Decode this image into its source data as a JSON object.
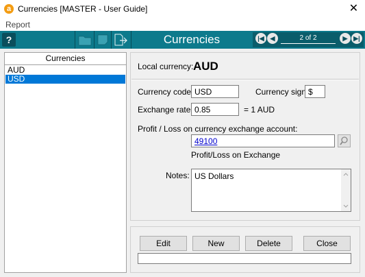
{
  "window": {
    "title": "Currencies [MASTER - User Guide]",
    "app_icon": "a",
    "close_glyph": "✕"
  },
  "menu": {
    "items": [
      "Report"
    ]
  },
  "toolbar": {
    "help_glyph": "?",
    "title": "Currencies",
    "page_indicator": "2 of 2",
    "nav_first_glyph": "|◀",
    "nav_prev_glyph": "◀",
    "nav_next_glyph": "▶",
    "nav_last_glyph": "▶|",
    "background_color": "#0d7a8c"
  },
  "list": {
    "header": "Currencies",
    "items": [
      {
        "label": "AUD",
        "selected": false
      },
      {
        "label": "USD",
        "selected": true
      }
    ],
    "selected_color": "#0078d7"
  },
  "detail": {
    "local_currency_label": "Local currency:",
    "local_currency_value": "AUD",
    "currency_code_label": "Currency code:",
    "currency_code_value": "USD",
    "currency_sign_label": "Currency sign:",
    "currency_sign_value": "$",
    "exchange_rate_label": "Exchange rate:",
    "exchange_rate_value": "0.85",
    "exchange_rate_suffix": "= 1 AUD",
    "account_label": "Profit / Loss on currency exchange account:",
    "account_value": "49100",
    "account_description": "Profit/Loss on Exchange",
    "notes_label": "Notes:",
    "notes_value": "US Dollars"
  },
  "buttons": {
    "edit": "Edit",
    "new": "New",
    "delete": "Delete",
    "close": "Close"
  }
}
